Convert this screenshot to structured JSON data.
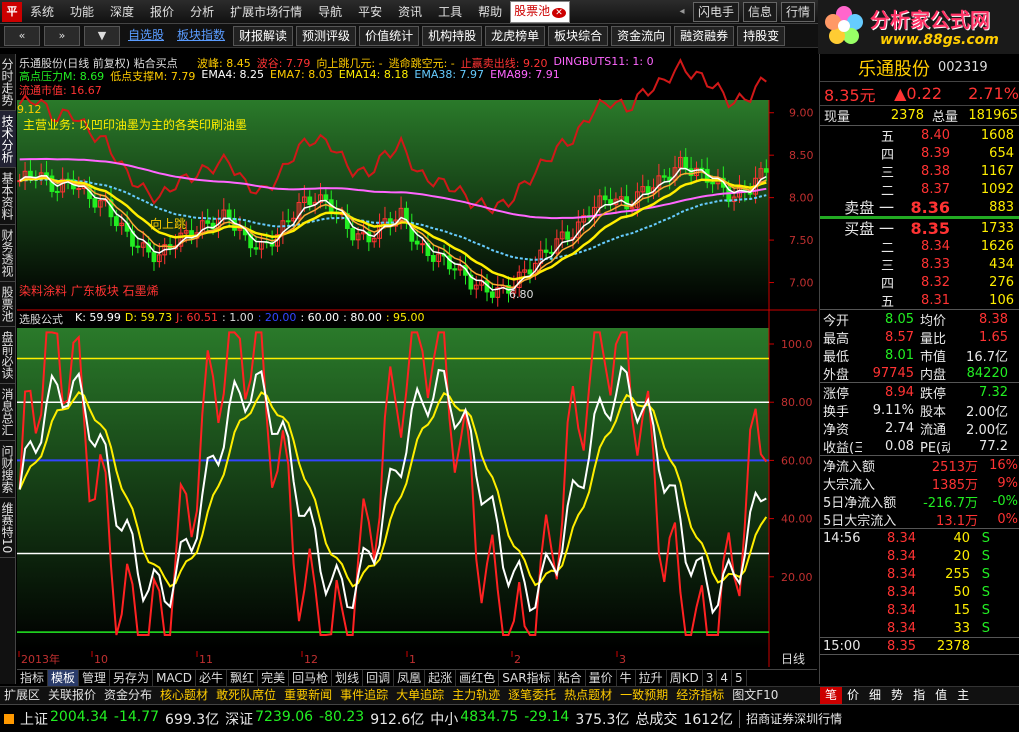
{
  "menu": {
    "items": [
      "系统",
      "功能",
      "深度",
      "报价",
      "分析",
      "扩展市场行情",
      "导航",
      "平安",
      "资讯",
      "工具",
      "帮助"
    ],
    "active_tab": "股票池",
    "right_buttons": [
      "闪电手",
      "信息",
      "行情"
    ]
  },
  "brand": {
    "name": "分析家公式网",
    "url": "www.88gs.com"
  },
  "toolbar": {
    "links": [
      "自选股",
      "板块指数"
    ],
    "buttons": [
      "财报解读",
      "预测评级",
      "价值统计",
      "机构持股",
      "龙虎榜单",
      "板块综合",
      "资金流向",
      "融资融券",
      "持股变"
    ]
  },
  "left_tabs": [
    "分时走势",
    "技术分析",
    "基本资料",
    "财务透视",
    "股票池",
    "盘前必读",
    "消息总汇",
    "问财搜索",
    "维赛特10"
  ],
  "main_chart": {
    "title": "乐通股份(日线 前复权) 粘合买点",
    "legend_line1": [
      {
        "text": "波峰: 8.45",
        "color": "#ffcc00"
      },
      {
        "text": "波谷: 7.79",
        "color": "#ff3333"
      },
      {
        "text": "向上跳几元: -",
        "color": "#ffcc00"
      },
      {
        "text": "逃命跳空元: -",
        "color": "#ffcc00"
      },
      {
        "text": "止赢卖出线: 9.20",
        "color": "#ff3333"
      },
      {
        "text": "DINGBUTS11: 1: 0",
        "color": "#ff66ff"
      }
    ],
    "legend_line2": [
      {
        "text": "高点压力M: 8.69",
        "color": "#22ee22"
      },
      {
        "text": "低点支撑M: 7.79",
        "color": "#ffcc00"
      },
      {
        "text": "EMA4: 8.25",
        "color": "#ffffff"
      },
      {
        "text": "EMA7: 8.03",
        "color": "#ffcc00"
      },
      {
        "text": "EMA14: 8.18",
        "color": "#ffee00"
      },
      {
        "text": "EMA38: 7.97",
        "color": "#66ccff"
      },
      {
        "text": "EMA89: 7.91",
        "color": "#ff66ff"
      }
    ],
    "legend_line3": {
      "text": "流通市值: 16.67",
      "color": "#ff3333"
    },
    "note_line1": "主营业务: 以凹印油墨为主的各类印刷油墨",
    "note_bottom": "染料涂料 广东板块 石墨烯",
    "marker_up": "向上跳",
    "low_label": "6.80",
    "high_label": "9.12",
    "y_ticks": [
      "9.00",
      "8.50",
      "8.00",
      "7.50",
      "7.00"
    ]
  },
  "sub_chart": {
    "title": "选股公式",
    "legend": [
      {
        "text": "K: 59.99",
        "color": "#ffffff"
      },
      {
        "text": "D: 59.73",
        "color": "#ffee00"
      },
      {
        "text": "J: 60.51",
        "color": "#ff3333"
      },
      {
        "text": ": 1.00",
        "color": "#dddddd"
      },
      {
        "text": ": 20.00",
        "color": "#3344ff"
      },
      {
        "text": ": 60.00",
        "color": "#ffffff"
      },
      {
        "text": ": 80.00",
        "color": "#ffffff"
      },
      {
        "text": ": 95.00",
        "color": "#ffee00"
      }
    ],
    "y_ticks": [
      "100.0",
      "80.00",
      "60.00",
      "40.00",
      "20.00"
    ]
  },
  "x_axis": {
    "labels": [
      "2013年",
      "10",
      "11",
      "12",
      "1",
      "2",
      "3"
    ],
    "mode": "日线"
  },
  "quote": {
    "name": "乐通股份",
    "code": "002319",
    "price": "8.35元",
    "change": "▲0.22",
    "pct": "2.71%",
    "now_label": "现量",
    "now_value": "2378",
    "total_label": "总量",
    "total_value": "181965",
    "sells": [
      {
        "label": "五",
        "price": "8.40",
        "vol": "1608"
      },
      {
        "label": "四",
        "price": "8.39",
        "vol": "654"
      },
      {
        "label": "三",
        "price": "8.38",
        "vol": "1167"
      },
      {
        "label": "二",
        "price": "8.37",
        "vol": "1092"
      },
      {
        "label": "卖盘 一",
        "price": "8.36",
        "vol": "883"
      }
    ],
    "buys": [
      {
        "label": "买盘 一",
        "price": "8.35",
        "vol": "1733"
      },
      {
        "label": "二",
        "price": "8.34",
        "vol": "1626"
      },
      {
        "label": "三",
        "price": "8.33",
        "vol": "434"
      },
      {
        "label": "四",
        "price": "8.32",
        "vol": "276"
      },
      {
        "label": "五",
        "price": "8.31",
        "vol": "106"
      }
    ],
    "stats": [
      [
        {
          "label": "今开",
          "value": "8.05",
          "color": "green"
        },
        {
          "label": "均价",
          "value": "8.38",
          "color": "red"
        }
      ],
      [
        {
          "label": "最高",
          "value": "8.57",
          "color": "red"
        },
        {
          "label": "量比",
          "value": "1.65",
          "color": "red"
        }
      ],
      [
        {
          "label": "最低",
          "value": "8.01",
          "color": "green"
        },
        {
          "label": "市值",
          "value": "16.7亿",
          "color": "white"
        }
      ],
      [
        {
          "label": "外盘",
          "value": "97745",
          "color": "red"
        },
        {
          "label": "内盘",
          "value": "84220",
          "color": "green"
        }
      ]
    ],
    "stats2": [
      [
        {
          "label": "涨停",
          "value": "8.94",
          "color": "red"
        },
        {
          "label": "跌停",
          "value": "7.32",
          "color": "green"
        }
      ],
      [
        {
          "label": "换手",
          "value": "9.11%",
          "color": "white"
        },
        {
          "label": "股本",
          "value": "2.00亿",
          "color": "white"
        }
      ],
      [
        {
          "label": "净资",
          "value": "2.74",
          "color": "white"
        },
        {
          "label": "流通",
          "value": "2.00亿",
          "color": "white"
        }
      ],
      [
        {
          "label": "收益(三)",
          "value": "0.08",
          "color": "white"
        },
        {
          "label": "PE(动)",
          "value": "77.2",
          "color": "white"
        }
      ]
    ],
    "flows": [
      {
        "label": "净流入额",
        "value": "2513万",
        "extra": "16%",
        "color": "red"
      },
      {
        "label": "大宗流入",
        "value": "1385万",
        "extra": "9%",
        "color": "red"
      },
      {
        "label": "5日净流入额",
        "value": "-216.7万",
        "extra": "-0%",
        "color": "green"
      },
      {
        "label": "5日大宗流入",
        "value": "13.1万",
        "extra": "0%",
        "color": "red"
      }
    ],
    "ticks": [
      {
        "time": "14:56",
        "price": "8.34",
        "vol": "40",
        "side": "S"
      },
      {
        "time": "",
        "price": "8.34",
        "vol": "20",
        "side": "S"
      },
      {
        "time": "",
        "price": "8.34",
        "vol": "255",
        "side": "S"
      },
      {
        "time": "",
        "price": "8.34",
        "vol": "50",
        "side": "S"
      },
      {
        "time": "",
        "price": "8.34",
        "vol": "15",
        "side": "S"
      },
      {
        "time": "",
        "price": "8.34",
        "vol": "33",
        "side": "S"
      },
      {
        "time": "15:00",
        "price": "8.35",
        "vol": "2378",
        "side": ""
      }
    ]
  },
  "bottom_tabs": [
    "指标",
    "模板",
    "管理",
    "另存为",
    "MACD",
    "必牛",
    "飘红",
    "完美",
    "回马枪",
    "划线",
    "回调",
    "凤凰",
    "起涨",
    "画红色",
    "SAR指标",
    "粘合",
    "量价",
    "牛",
    "拉升",
    "周KD",
    "3",
    "4",
    "5"
  ],
  "func_bar": [
    "扩展区",
    "关联报价",
    "资金分布",
    "核心题材",
    "敢死队席位",
    "重要新闻",
    "事件追踪",
    "大单追踪",
    "主力轨迹",
    "逐笔委托",
    "热点题材",
    "一致预期",
    "经济指标",
    "图文F10"
  ],
  "right_tabs": [
    "笔",
    "价",
    "细",
    "势",
    "指",
    "值",
    "主"
  ],
  "status": [
    {
      "label": "上证",
      "value": "2004.34",
      "chg": "-14.77",
      "amt": "699.3亿"
    },
    {
      "label": "深证",
      "value": "7239.06",
      "chg": "-80.23",
      "amt": "912.6亿"
    },
    {
      "label": "中小",
      "value": "4834.75",
      "chg": "-29.14",
      "amt": "375.3亿"
    }
  ],
  "status_total_label": "总成交",
  "status_total_value": "1612亿",
  "status_broker": "招商证券深圳行情",
  "colors": {
    "up": "#ff3333",
    "down": "#22ee22",
    "accent": "#ffcc00"
  }
}
